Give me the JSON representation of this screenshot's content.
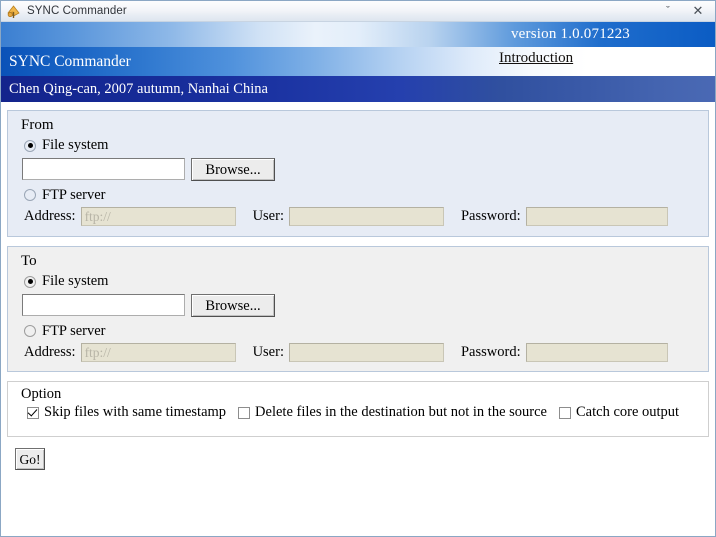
{
  "window": {
    "title": "SYNC Commander",
    "icon": "app-sync-icon",
    "controls": {
      "chevron": "ˇ",
      "close": "✕"
    }
  },
  "banner": {
    "version": "version 1.0.071223",
    "brand": "SYNC Commander",
    "introduction_link": "Introduction",
    "author": "Chen Qing-can, 2007 autumn, Nanhai China"
  },
  "from": {
    "legend": "From",
    "file_system_label": "File system",
    "file_system_selected": true,
    "path_value": "",
    "browse_label": "Browse...",
    "ftp_label": "FTP server",
    "ftp_selected": false,
    "address_label": "Address:",
    "address_placeholder": "ftp://",
    "address_value": "",
    "user_label": "User:",
    "user_value": "",
    "password_label": "Password:",
    "password_value": ""
  },
  "to": {
    "legend": "To",
    "file_system_label": "File system",
    "file_system_selected": true,
    "path_value": "",
    "browse_label": "Browse...",
    "ftp_label": "FTP server",
    "ftp_selected": false,
    "address_label": "Address:",
    "address_placeholder": "ftp://",
    "address_value": "",
    "user_label": "User:",
    "user_value": "",
    "password_label": "Password:",
    "password_value": ""
  },
  "option": {
    "legend": "Option",
    "skip_label": "Skip files with same timestamp",
    "skip_checked": true,
    "delete_label": "Delete files in the destination but not in the source",
    "delete_checked": false,
    "catch_label": "Catch core output",
    "catch_checked": false
  },
  "actions": {
    "go_label": "Go!"
  },
  "colors": {
    "accent_blue": "#0b5cc4",
    "navy": "#1b33a2",
    "panel_from_bg": "#e7ecf5",
    "panel_to_bg": "#f0f0f0",
    "disabled_field_bg": "#e6e3d2"
  }
}
